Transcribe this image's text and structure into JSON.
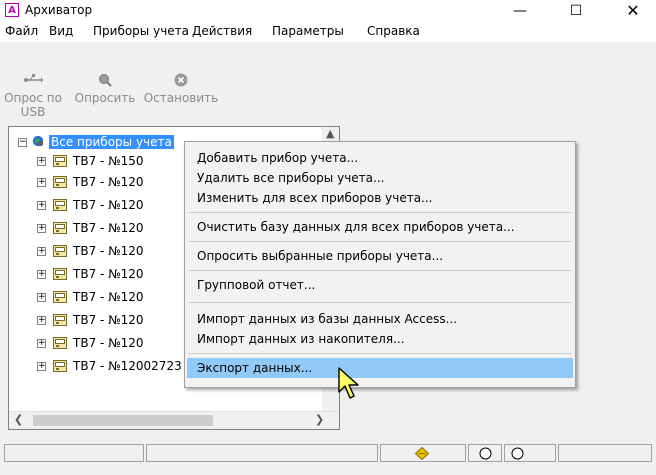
{
  "window": {
    "title": "Архиватор"
  },
  "menu": [
    "Файл",
    "Вид",
    "Приборы учета",
    "Действия",
    "Параметры",
    "Справка"
  ],
  "toolbar": {
    "poll_usb": "Опрос по USB",
    "poll": "Опросить",
    "stop": "Остановить"
  },
  "tree": {
    "root": "Все приборы учета",
    "items": [
      "ТВ7 - №150",
      "ТВ7 - №120",
      "ТВ7 - №120",
      "ТВ7 - №120",
      "ТВ7 - №120",
      "ТВ7 - №120",
      "ТВ7 - №120",
      "ТВ7 - №120",
      "ТВ7 - №120",
      "ТВ7 - №12002723"
    ]
  },
  "context_menu": {
    "items": [
      "Добавить прибор учета...",
      "Удалить все приборы учета...",
      "Изменить для всех приборов учета...",
      "Очистить базу данных для всех приборов учета...",
      "Опросить выбранные приборы учета...",
      "Групповой отчет...",
      "Импорт данных из базы данных Access...",
      "Импорт данных из накопителя...",
      "Экспорт данных..."
    ]
  },
  "colors": {
    "selection": "#3390ff",
    "menu_highlight": "#91c9f7",
    "brand": "#c000c0"
  }
}
